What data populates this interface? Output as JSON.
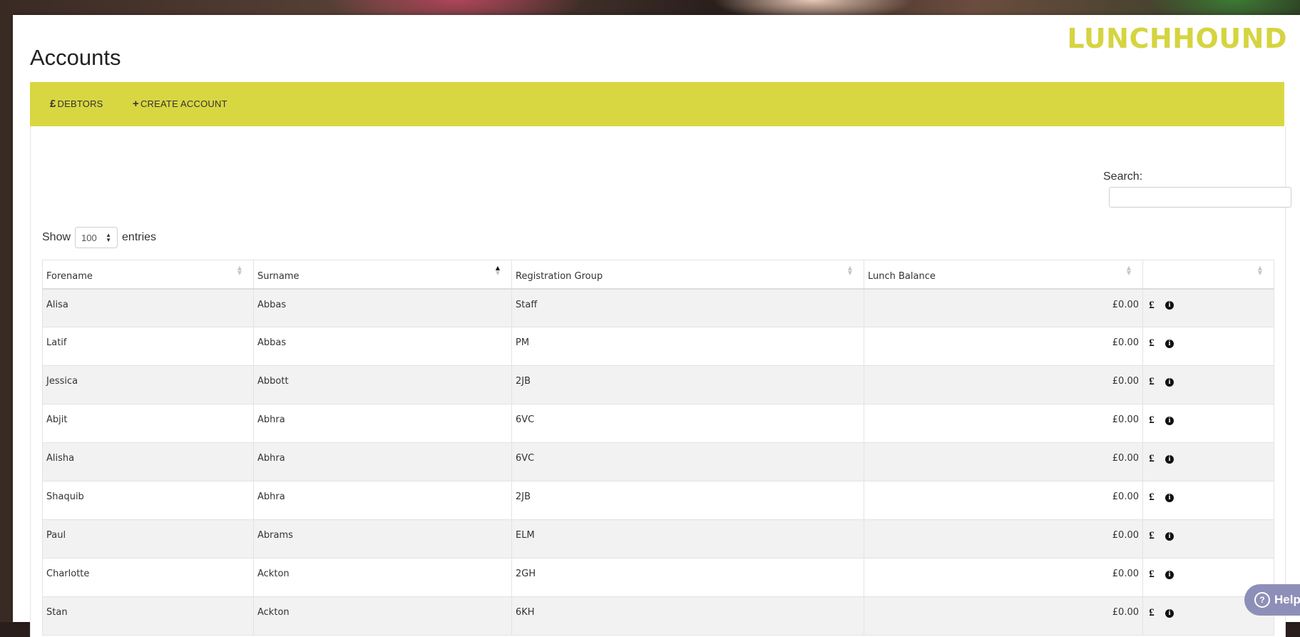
{
  "brand": {
    "logo_text": "LUNCHHOUND",
    "accent_color": "#d8d742"
  },
  "page": {
    "title": "Accounts"
  },
  "toolbar": {
    "debtors": {
      "icon": "£",
      "label": "DEBTORS"
    },
    "create_account": {
      "icon": "+",
      "label": "CREATE ACCOUNT"
    }
  },
  "search": {
    "label": "Search:",
    "value": ""
  },
  "length": {
    "prefix": "Show",
    "value": "100",
    "suffix": "entries"
  },
  "table": {
    "columns": [
      "Forename",
      "Surname",
      "Registration Group",
      "Lunch Balance",
      ""
    ],
    "sorted_column": "Surname",
    "rows": [
      {
        "forename": "Alisa",
        "surname": "Abbas",
        "group": "Staff",
        "balance": "£0.00"
      },
      {
        "forename": "Latif",
        "surname": "Abbas",
        "group": "PM",
        "balance": "£0.00"
      },
      {
        "forename": "Jessica",
        "surname": "Abbott",
        "group": "2JB",
        "balance": "£0.00"
      },
      {
        "forename": "Abjit",
        "surname": "Abhra",
        "group": "6VC",
        "balance": "£0.00"
      },
      {
        "forename": "Alisha",
        "surname": "Abhra",
        "group": "6VC",
        "balance": "£0.00"
      },
      {
        "forename": "Shaquib",
        "surname": "Abhra",
        "group": "2JB",
        "balance": "£0.00"
      },
      {
        "forename": "Paul",
        "surname": "Abrams",
        "group": "ELM",
        "balance": "£0.00"
      },
      {
        "forename": "Charlotte",
        "surname": "Ackton",
        "group": "2GH",
        "balance": "£0.00"
      },
      {
        "forename": "Stan",
        "surname": "Ackton",
        "group": "6KH",
        "balance": "£0.00"
      }
    ],
    "row_action_icons": [
      "pound-icon",
      "info-icon"
    ]
  },
  "help": {
    "label": "Help"
  }
}
